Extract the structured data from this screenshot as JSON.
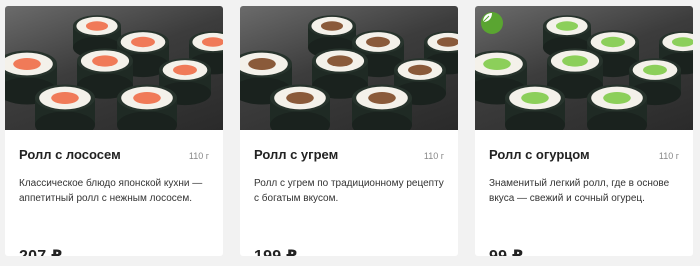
{
  "products": [
    {
      "name": "Ролл с лососем",
      "weight": "110 г",
      "description": "Классическое блюдо японской кухни — аппетитный ролл с нежным лососем.",
      "price": "207 ₽",
      "image_icon": "salmon-roll-photo",
      "fill_color": "#f07a58",
      "vegetarian": false
    },
    {
      "name": "Ролл с угрем",
      "weight": "110 г",
      "description": "Ролл с угрем по традиционному рецепту с богатым вкусом.",
      "price": "199 ₽",
      "image_icon": "eel-roll-photo",
      "fill_color": "#8a5a3a",
      "vegetarian": false
    },
    {
      "name": "Ролл с огурцом",
      "weight": "110 г",
      "description": "Знаменитый легкий ролл, где в основе вкуса — свежий и сочный огурец.",
      "price": "99 ₽",
      "image_icon": "cucumber-roll-photo",
      "fill_color": "#8ccf5a",
      "vegetarian": true,
      "badge_icon": "leaf-icon"
    }
  ]
}
